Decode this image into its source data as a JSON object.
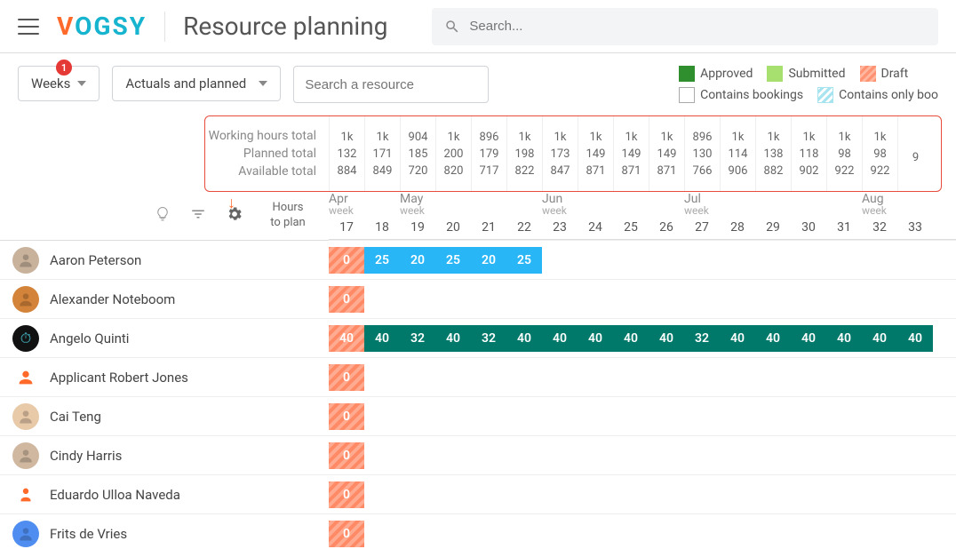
{
  "header": {
    "title": "Resource planning",
    "logo_v": "V",
    "logo_rest": "OGSY",
    "search_placeholder": "Search..."
  },
  "toolbar": {
    "weeks_label": "Weeks",
    "weeks_badge": "1",
    "mode_label": "Actuals and planned",
    "search_res_placeholder": "Search a resource"
  },
  "legend": {
    "approved": "Approved",
    "submitted": "Submitted",
    "draft": "Draft",
    "contains": "Contains bookings",
    "only": "Contains only boo"
  },
  "totals_labels": {
    "working": "Working hours total",
    "planned": "Planned total",
    "available": "Available total"
  },
  "hours_label": {
    "l1": "Hours",
    "l2": "to plan"
  },
  "months": [
    {
      "name": "Apr",
      "at": 0
    },
    {
      "name": "May",
      "at": 2
    },
    {
      "name": "Jun",
      "at": 6
    },
    {
      "name": "Jul",
      "at": 10
    },
    {
      "name": "Aug",
      "at": 15
    }
  ],
  "weeks": [
    "17",
    "18",
    "19",
    "20",
    "21",
    "22",
    "23",
    "24",
    "25",
    "26",
    "27",
    "28",
    "29",
    "30",
    "31",
    "32",
    "33"
  ],
  "totals": {
    "working": [
      "1k",
      "1k",
      "904",
      "1k",
      "896",
      "1k",
      "1k",
      "1k",
      "1k",
      "1k",
      "896",
      "1k",
      "1k",
      "1k",
      "1k",
      "1k",
      ""
    ],
    "planned": [
      "132",
      "171",
      "185",
      "200",
      "179",
      "198",
      "173",
      "149",
      "149",
      "149",
      "130",
      "114",
      "138",
      "118",
      "98",
      "98",
      ""
    ],
    "available": [
      "884",
      "849",
      "720",
      "820",
      "717",
      "822",
      "847",
      "871",
      "871",
      "871",
      "766",
      "906",
      "882",
      "902",
      "922",
      "922",
      "9"
    ]
  },
  "resources": [
    {
      "name": "Aaron Peterson",
      "avatar_bg": "#c9b29b",
      "emoji": "",
      "hours": "0",
      "cells": [
        {
          "v": "25",
          "c": "blue"
        },
        {
          "v": "20",
          "c": "blue"
        },
        {
          "v": "25",
          "c": "blue"
        },
        {
          "v": "20",
          "c": "blue"
        },
        {
          "v": "25",
          "c": "blue"
        }
      ]
    },
    {
      "name": "Alexander Noteboom",
      "avatar_bg": "#d4843a",
      "emoji": "",
      "hours": "0",
      "cells": []
    },
    {
      "name": "Angelo Quinti",
      "avatar_bg": "#111",
      "emoji": "⏱",
      "hours": "40",
      "cells": [
        {
          "v": "40",
          "c": "teal"
        },
        {
          "v": "32",
          "c": "teal"
        },
        {
          "v": "40",
          "c": "teal"
        },
        {
          "v": "32",
          "c": "teal"
        },
        {
          "v": "40",
          "c": "teal"
        },
        {
          "v": "40",
          "c": "teal"
        },
        {
          "v": "40",
          "c": "teal"
        },
        {
          "v": "40",
          "c": "teal"
        },
        {
          "v": "40",
          "c": "teal"
        },
        {
          "v": "32",
          "c": "teal"
        },
        {
          "v": "40",
          "c": "teal"
        },
        {
          "v": "40",
          "c": "teal"
        },
        {
          "v": "40",
          "c": "teal"
        },
        {
          "v": "40",
          "c": "teal"
        },
        {
          "v": "40",
          "c": "teal"
        },
        {
          "v": "40",
          "c": "teal"
        }
      ]
    },
    {
      "name": "Applicant Robert Jones",
      "avatar_bg": "#fff",
      "emoji": "",
      "icon": "person-outline",
      "hours": "0",
      "cells": []
    },
    {
      "name": "Cai Teng",
      "avatar_bg": "#e8c9a8",
      "emoji": "",
      "hours": "0",
      "cells": []
    },
    {
      "name": "Cindy Harris",
      "avatar_bg": "#d0b8a0",
      "emoji": "",
      "hours": "0",
      "cells": []
    },
    {
      "name": "Eduardo Ulloa Naveda",
      "avatar_bg": "#fff",
      "emoji": "",
      "icon": "person-suit",
      "hours": "0",
      "cells": []
    },
    {
      "name": "Frits de Vries",
      "avatar_bg": "#4f8ef0",
      "emoji": "",
      "hours": "0",
      "cells": []
    }
  ]
}
